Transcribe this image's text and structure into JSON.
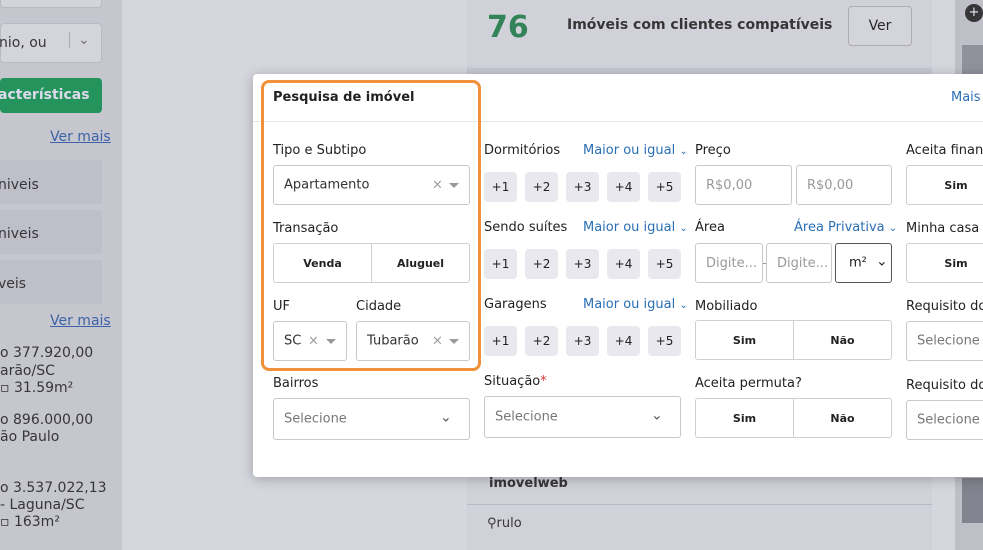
{
  "background": {
    "left_input_text": "nio, ou",
    "left_button": "acterísticas",
    "ver_mais_1": "Ver mais",
    "left_items": [
      "niveis",
      "niveis",
      "veis"
    ],
    "ver_mais_2": "Ver mais",
    "listings": [
      {
        "line1": "o 377.920,00",
        "line2": "arão/SC",
        "area": "31.59m²"
      },
      {
        "line1": "o 896.000,00",
        "line2": "ão Paulo",
        "area": ""
      },
      {
        "line1": "o 3.537.022,13",
        "line2": "- Laguna/SC",
        "area": "163m²"
      }
    ],
    "count": "76",
    "count_label": "Imóveis com clientes compatíveis",
    "ver_button": "Ver",
    "partner1": "imovelweb",
    "partner2": "rulo"
  },
  "modal": {
    "title": "Pesquisa de imóvel",
    "more_link": "Mais",
    "tipo": {
      "label": "Tipo e Subtipo",
      "value": "Apartamento"
    },
    "transacao": {
      "label": "Transação",
      "options": [
        "Venda",
        "Aluguel"
      ]
    },
    "uf": {
      "label": "UF",
      "value": "SC"
    },
    "cidade": {
      "label": "Cidade",
      "value": "Tubarão"
    },
    "bairros": {
      "label": "Bairros",
      "placeholder": "Selecione"
    },
    "dormitorios": {
      "label": "Dormitórios",
      "mode": "Maior ou igual",
      "options": [
        "+1",
        "+2",
        "+3",
        "+4",
        "+5"
      ]
    },
    "suites": {
      "label": "Sendo suítes",
      "mode": "Maior ou igual",
      "options": [
        "+1",
        "+2",
        "+3",
        "+4",
        "+5"
      ]
    },
    "garagens": {
      "label": "Garagens",
      "mode": "Maior ou igual",
      "options": [
        "+1",
        "+2",
        "+3",
        "+4",
        "+5"
      ]
    },
    "situacao": {
      "label": "Situação",
      "required": "*",
      "placeholder": "Selecione"
    },
    "preco": {
      "label": "Preço",
      "min_placeholder": "R$0,00",
      "max_placeholder": "R$0,00"
    },
    "area": {
      "label": "Área",
      "type": "Área Privativa",
      "min_placeholder": "Digite...",
      "max_placeholder": "Digite...",
      "unit": "m²"
    },
    "mobiliado": {
      "label": "Mobiliado",
      "options": [
        "Sim",
        "Não"
      ]
    },
    "permuta": {
      "label": "Aceita permuta?",
      "options": [
        "Sim",
        "Não"
      ]
    },
    "financiamento": {
      "label": "Aceita financ",
      "option": "Sim"
    },
    "minha_casa": {
      "label": "Minha casa m",
      "option": "Sim"
    },
    "requisito1": {
      "label": "Requisito do",
      "placeholder": "Selecione"
    },
    "requisito2": {
      "label": "Requisito do",
      "placeholder": "Selecione"
    }
  },
  "colors": {
    "accent": "#2a6fb5",
    "highlight": "#f0913a",
    "green": "#1f9d5c",
    "count_green": "#2e8a57"
  }
}
